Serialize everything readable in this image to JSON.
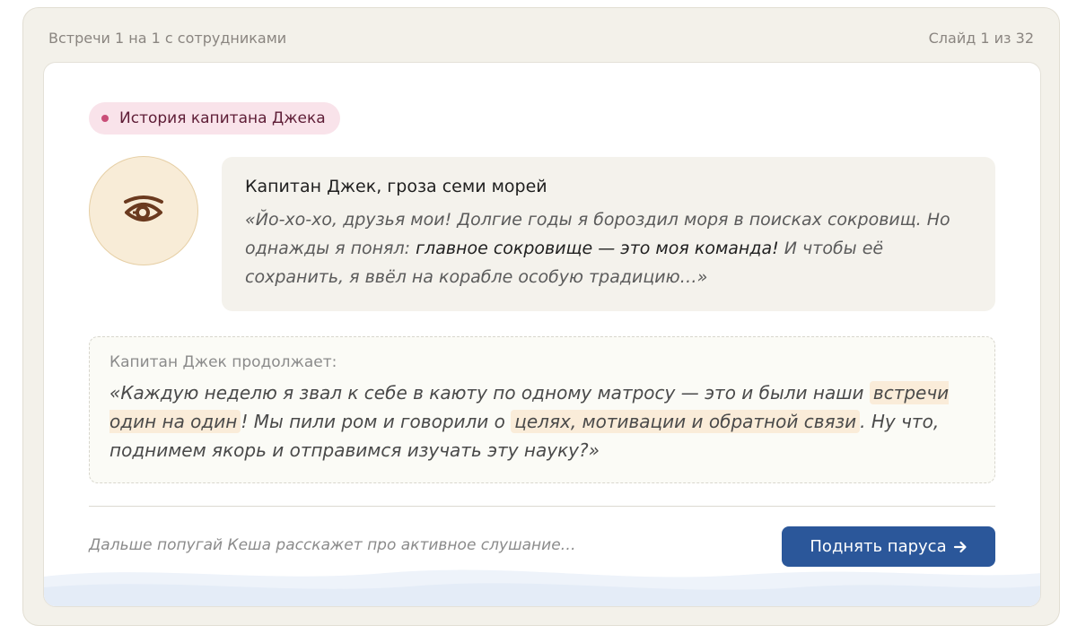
{
  "header": {
    "title": "Встречи 1 на 1 с сотрудниками",
    "slide_counter": "Слайд 1 из 32"
  },
  "tag": {
    "label": "История капитана Джека",
    "dot_color": "#c94e78"
  },
  "avatar": {
    "icon": "pirate-eye-icon"
  },
  "speech": {
    "speaker": "Капитан Джек, гроза семи морей",
    "quote_part1": "«Йо-хо-хо, друзья мои! Долгие годы я бороздил моря в поисках сокровищ. Но однажды я понял: ",
    "quote_emphasis": "главное сокровище — это моя команда!",
    "quote_part2": " И чтобы её сохранить, я ввёл на корабле особую традицию…»"
  },
  "continuation": {
    "heading": "Капитан Джек продолжает:",
    "text_part1": "«Каждую неделю я звал к себе в каюту по одному матросу — это и были наши ",
    "highlight1": "встречи один на один",
    "text_part2": "! Мы пили ром и говорили о ",
    "highlight2": "целях, мотивации и обратной связи",
    "text_part3": ". Ну что, поднимем якорь и отправимся изучать эту науку?»"
  },
  "footer": {
    "next_hint": "Дальше попугай Кеша расскажет про активное слушание…",
    "button_label": "Поднять паруса",
    "button_icon": "arrow-right-icon",
    "button_color": "#2b579a"
  }
}
